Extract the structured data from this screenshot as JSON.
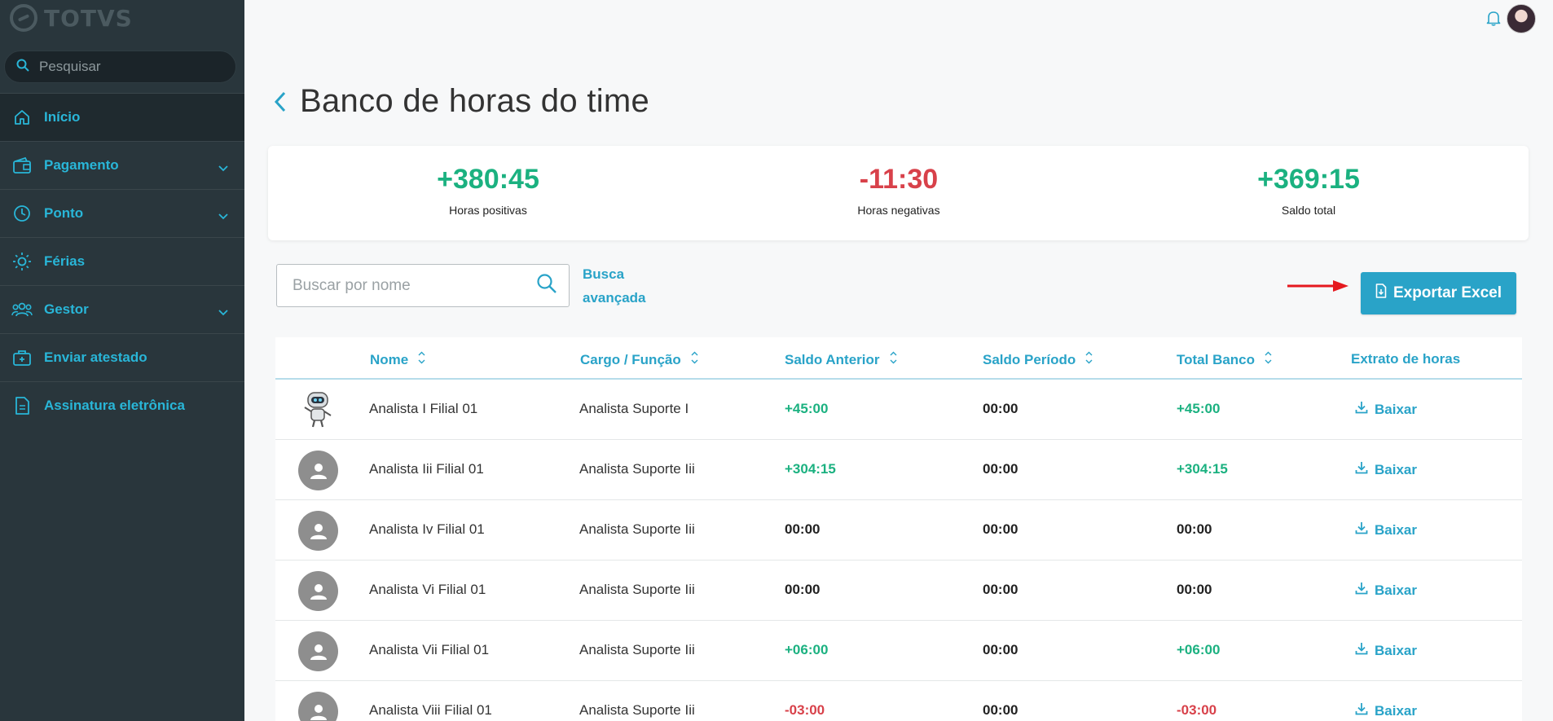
{
  "app": {
    "logo_text": "TOTVS"
  },
  "colors": {
    "accent": "#29a3c8",
    "positive": "#1bb180",
    "negative": "#d8414a",
    "sidebar_bg": "#29363c"
  },
  "sidebar": {
    "search_placeholder": "Pesquisar",
    "items": [
      {
        "label": "Início",
        "icon": "home-icon",
        "expandable": false,
        "active": true
      },
      {
        "label": "Pagamento",
        "icon": "wallet-icon",
        "expandable": true
      },
      {
        "label": "Ponto",
        "icon": "clock-icon",
        "expandable": true
      },
      {
        "label": "Férias",
        "icon": "sun-icon",
        "expandable": false
      },
      {
        "label": "Gestor",
        "icon": "team-icon",
        "expandable": true
      },
      {
        "label": "Enviar atestado",
        "icon": "medical-case-icon",
        "expandable": false
      },
      {
        "label": "Assinatura eletrônica",
        "icon": "document-icon",
        "expandable": false
      }
    ]
  },
  "header": {
    "title": "Banco de horas do time"
  },
  "summary": {
    "positive": {
      "value": "+380:45",
      "label": "Horas positivas"
    },
    "negative": {
      "value": "-11:30",
      "label": "Horas negativas"
    },
    "total": {
      "value": "+369:15",
      "label": "Saldo total"
    }
  },
  "toolbar": {
    "search_placeholder": "Buscar por nome",
    "advanced_search_line1": "Busca",
    "advanced_search_line2": "avançada",
    "export_label": "Exportar Excel"
  },
  "table": {
    "columns": {
      "name": "Nome",
      "role": "Cargo / Função",
      "previous": "Saldo Anterior",
      "period": "Saldo Período",
      "total": "Total Banco",
      "statement": "Extrato de horas"
    },
    "download_label": "Baixar",
    "rows": [
      {
        "name": "Analista I Filial 01",
        "role": "Analista Suporte I",
        "previous": "+45:00",
        "period": "00:00",
        "total": "+45:00",
        "avatar": "robot"
      },
      {
        "name": "Analista Iii Filial 01",
        "role": "Analista Suporte Iii",
        "previous": "+304:15",
        "period": "00:00",
        "total": "+304:15",
        "avatar": "default"
      },
      {
        "name": "Analista Iv Filial 01",
        "role": "Analista Suporte Iii",
        "previous": "00:00",
        "period": "00:00",
        "total": "00:00",
        "avatar": "default"
      },
      {
        "name": "Analista Vi Filial 01",
        "role": "Analista Suporte Iii",
        "previous": "00:00",
        "period": "00:00",
        "total": "00:00",
        "avatar": "default"
      },
      {
        "name": "Analista Vii Filial 01",
        "role": "Analista Suporte Iii",
        "previous": "+06:00",
        "period": "00:00",
        "total": "+06:00",
        "avatar": "default"
      },
      {
        "name": "Analista Viii Filial 01",
        "role": "Analista Suporte Iii",
        "previous": "-03:00",
        "period": "00:00",
        "total": "-03:00",
        "avatar": "default"
      }
    ]
  }
}
